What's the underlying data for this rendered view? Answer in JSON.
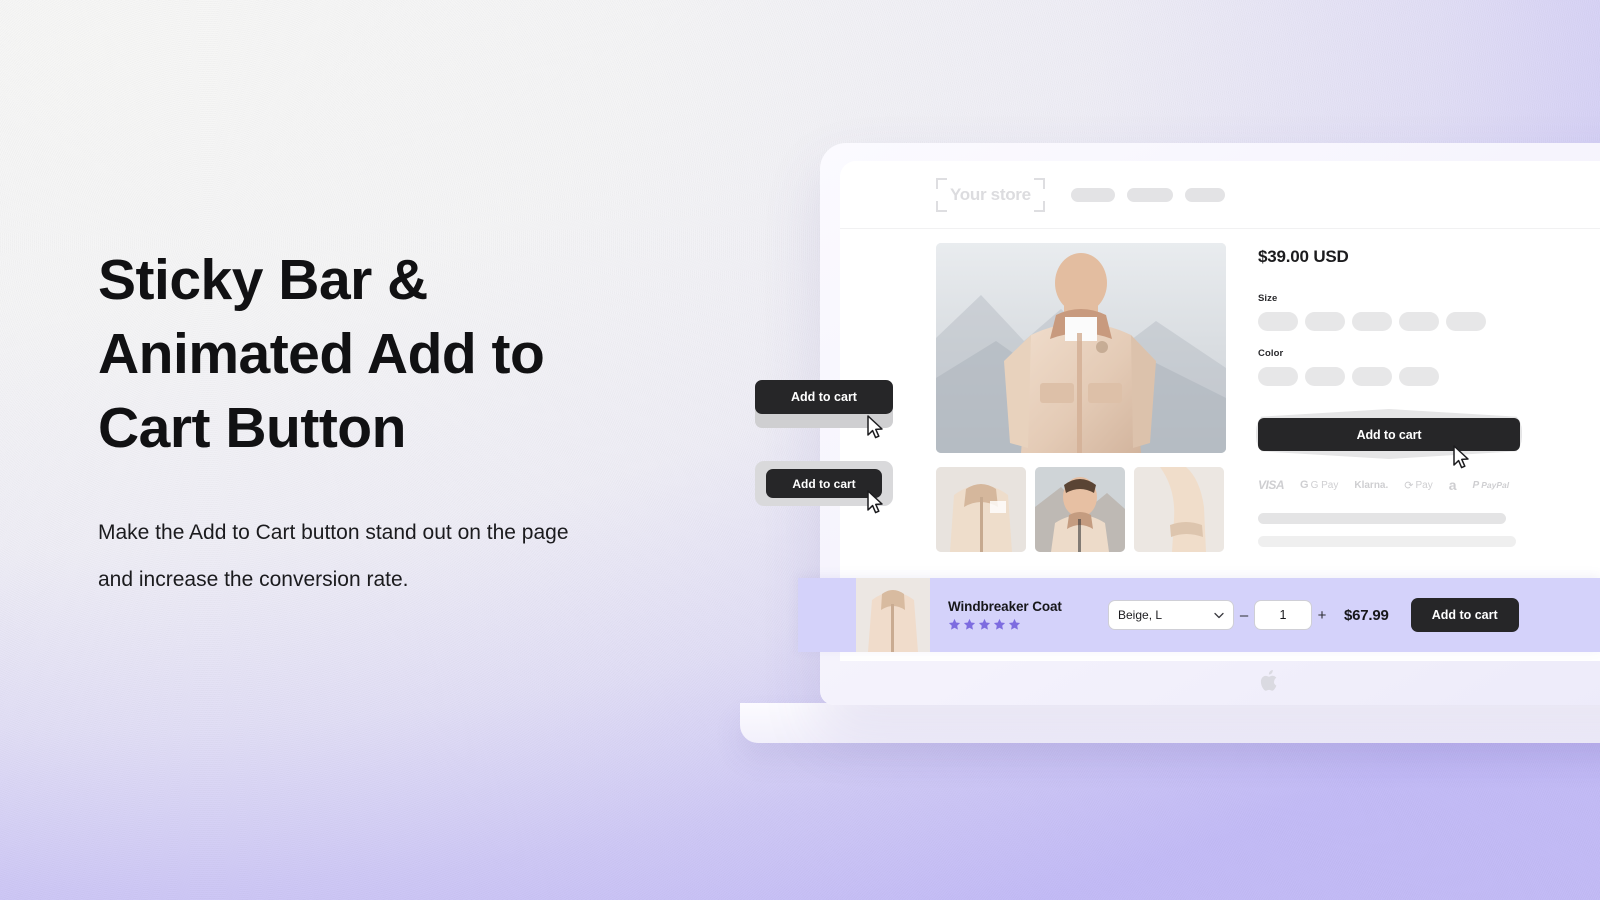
{
  "hero": {
    "headline": "Sticky Bar & Animated Add to Cart Button",
    "subcopy": "Make the Add to Cart button stand out on the page and increase the conversion rate."
  },
  "colors": {
    "accent_lavender": "#d4d2fa",
    "button_dark": "#262628",
    "star_purple": "#7d6ce0",
    "bg_gradient_start": "#f7f7f6",
    "bg_gradient_end": "#c4bcf7"
  },
  "store_header": {
    "logo_text": "Your store",
    "nav_pills": [
      42,
      44,
      38
    ],
    "icons": [
      "search-icon",
      "heart-icon"
    ]
  },
  "product": {
    "price": "$39.00 USD",
    "options": [
      {
        "label": "Size",
        "swatch_count": 5
      },
      {
        "label": "Color",
        "swatch_count": 4
      }
    ],
    "add_to_cart_label": "Add to cart",
    "payment_methods": [
      {
        "name": "visa",
        "text": "VISA"
      },
      {
        "name": "google-pay",
        "text": "G Pay"
      },
      {
        "name": "klarna",
        "text": "Klarna."
      },
      {
        "name": "shop-pay",
        "text": "Pay"
      },
      {
        "name": "amazon-pay",
        "text": "a"
      },
      {
        "name": "paypal",
        "text": "PayPal"
      }
    ],
    "description_bars": 2,
    "thumbnail_count": 3
  },
  "sticky_bar": {
    "product_title": "Windbreaker Coat",
    "rating_stars": 5,
    "variant_value": "Beige, L",
    "decrement_label": "–",
    "increment_label": "+",
    "quantity": "1",
    "price": "$67.99",
    "add_to_cart_label": "Add to cart"
  },
  "callouts": [
    {
      "label": "Add to cart",
      "style": "wide-shadow"
    },
    {
      "label": "Add to cart",
      "style": "inset-ring"
    }
  ],
  "device": {
    "brand_icon": "apple-logo"
  }
}
